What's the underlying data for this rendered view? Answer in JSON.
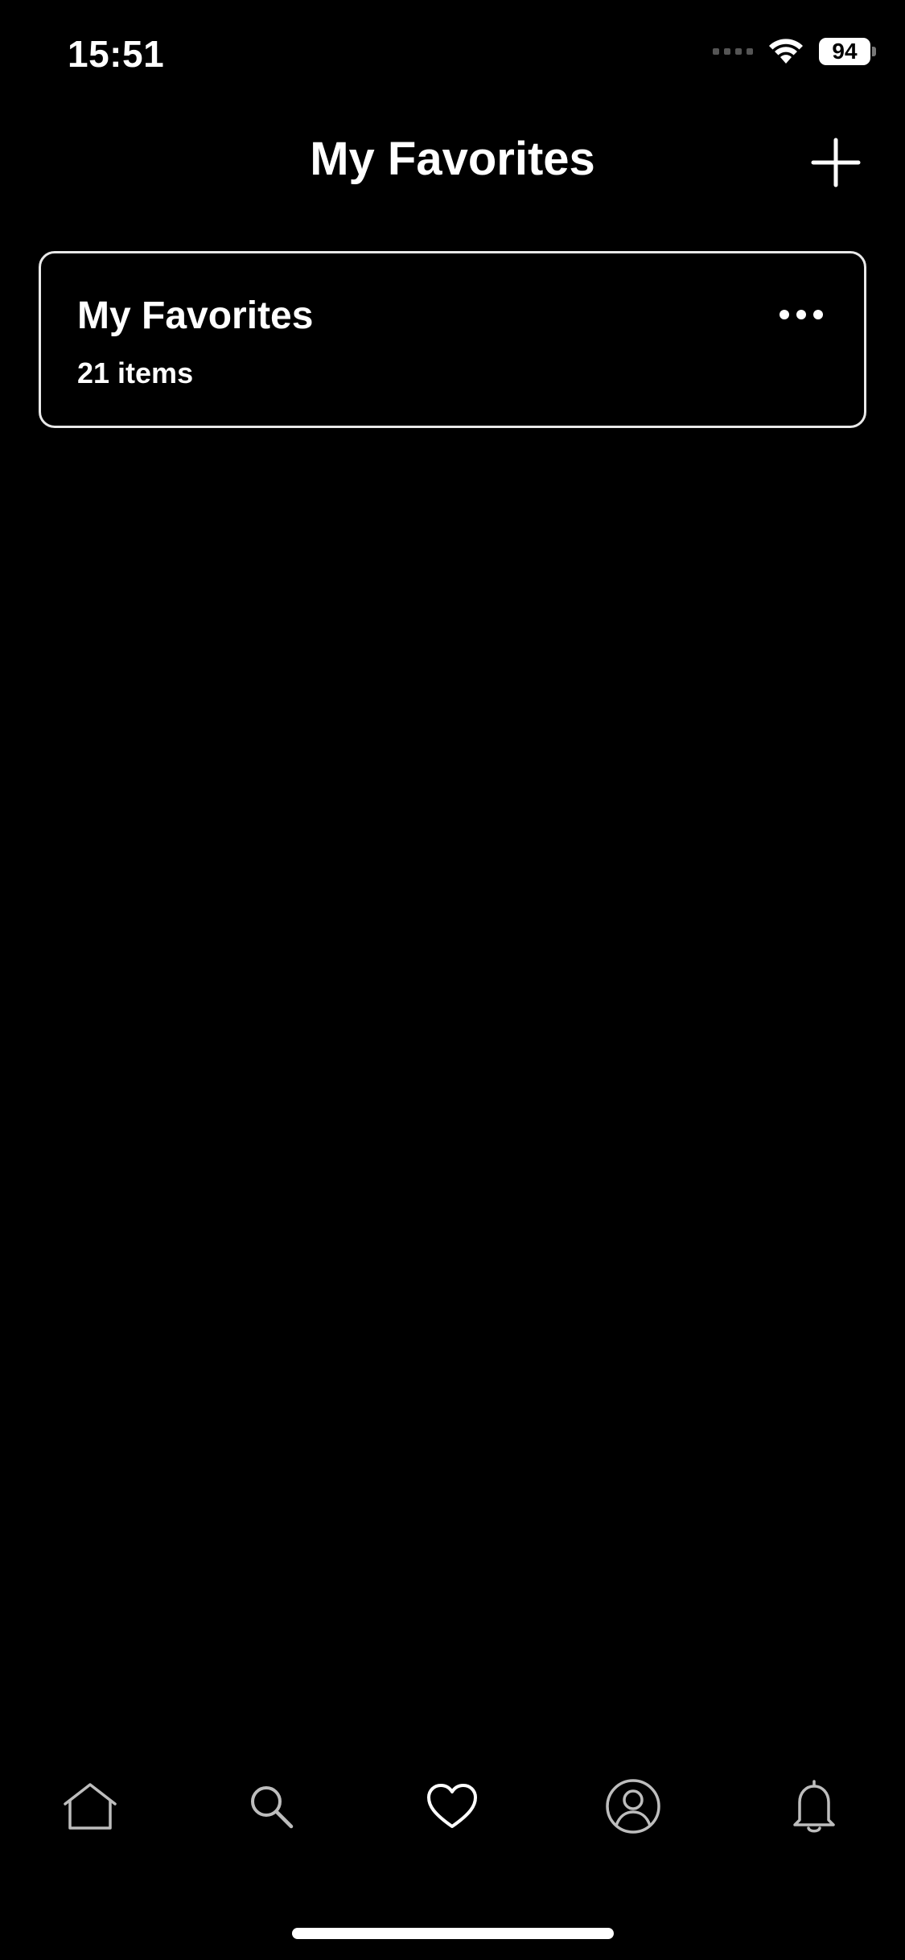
{
  "status_bar": {
    "time": "15:51",
    "battery": "94"
  },
  "header": {
    "title": "My Favorites",
    "add_icon": "plus-icon"
  },
  "lists": [
    {
      "title": "My Favorites",
      "subtitle": "21 items",
      "menu_icon": "ellipsis-icon"
    }
  ],
  "tab_bar": {
    "tabs": [
      {
        "icon": "home-icon",
        "active": false
      },
      {
        "icon": "search-icon",
        "active": false
      },
      {
        "icon": "heart-icon",
        "active": true
      },
      {
        "icon": "profile-icon",
        "active": false
      },
      {
        "icon": "bell-icon",
        "active": false
      }
    ]
  },
  "colors": {
    "background": "#000000",
    "foreground": "#ffffff",
    "inactive_icon": "#bdbdbd",
    "card_border": "#e9e9e9"
  }
}
